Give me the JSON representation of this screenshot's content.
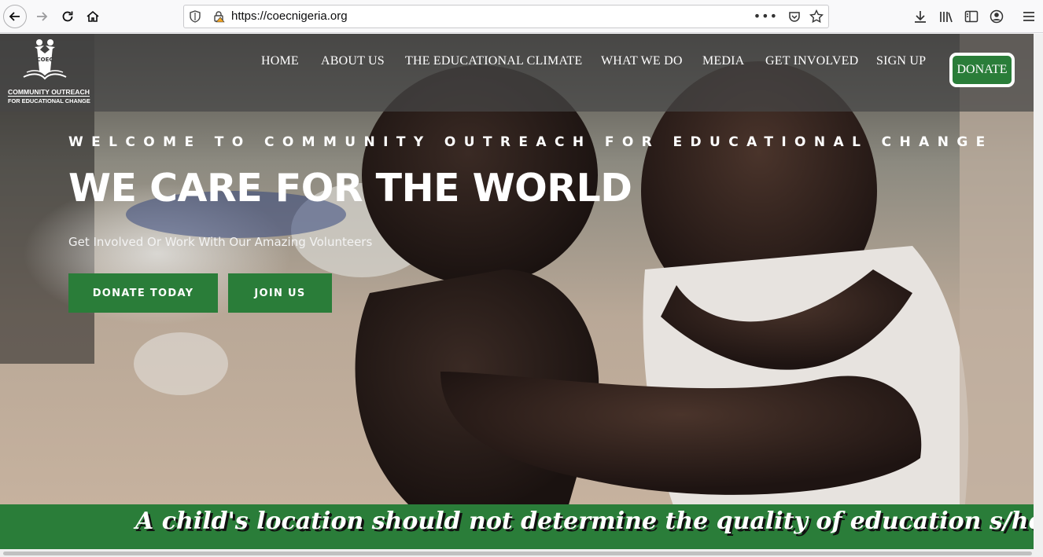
{
  "browser": {
    "url": "https://coecnigeria.org",
    "menu_dots": "•••"
  },
  "logo": {
    "letters": "COEC",
    "line1": "COMMUNITY OUTREACH",
    "line2": "FOR EDUCATIONAL CHANGE"
  },
  "nav": {
    "items": [
      {
        "label": "HOME"
      },
      {
        "label": "ABOUT US"
      },
      {
        "label": "THE EDUCATIONAL CLIMATE"
      },
      {
        "label": "WHAT WE DO"
      },
      {
        "label": "MEDIA"
      },
      {
        "label": "GET INVOLVED"
      },
      {
        "label": "SIGN UP"
      }
    ],
    "donate_label": "DONATE"
  },
  "hero": {
    "welcome": "WELCOME TO COMMUNITY OUTREACH FOR EDUCATIONAL CHANGE",
    "title": "WE CARE FOR THE WORLD",
    "subtitle": "Get Involved Or Work With Our Amazing Volunteers",
    "donate_button": "DONATE TODAY",
    "join_button": "JOIN US"
  },
  "banner": {
    "text": "A child's location should not determine the quality of education s/he"
  },
  "colors": {
    "brand_green": "#2a7d39",
    "header_overlay": "#464646"
  }
}
